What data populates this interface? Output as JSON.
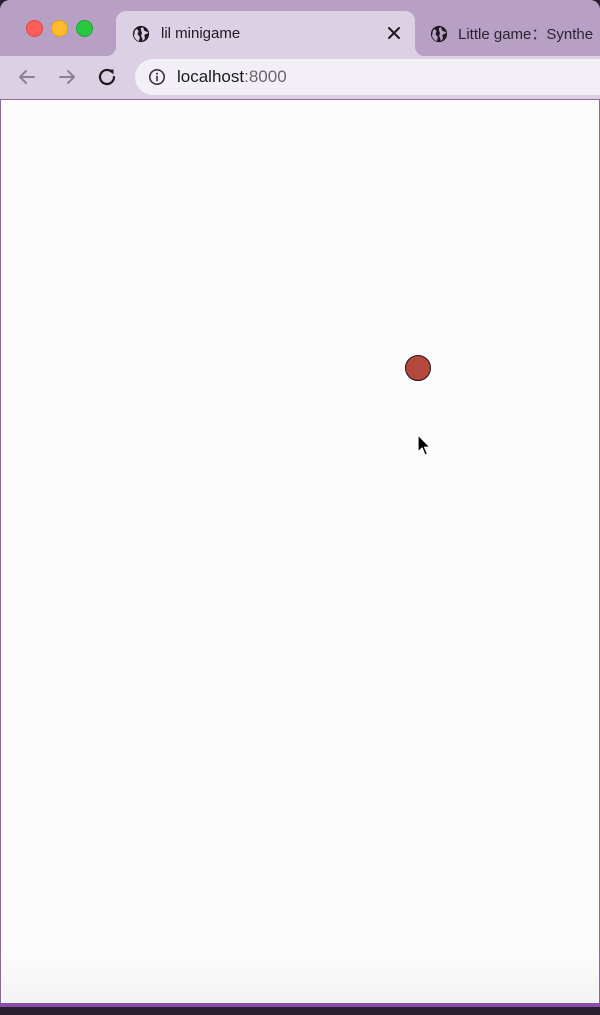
{
  "window": {
    "controls": [
      "close",
      "minimize",
      "zoom"
    ]
  },
  "tabs": [
    {
      "title": "lil minigame",
      "icon": "globe-icon",
      "active": true,
      "close_glyph": "✕"
    },
    {
      "title": "Little game：Synthe",
      "icon": "globe-icon",
      "active": false
    }
  ],
  "toolbar": {
    "back_icon": "arrow-left-icon",
    "forward_icon": "arrow-right-icon",
    "reload_icon": "reload-icon",
    "site_info_icon": "info-icon"
  },
  "address_bar": {
    "host": "localhost",
    "port": ":8000"
  },
  "game": {
    "player_color": "#b5483c",
    "background_color": "#fdfcfd"
  },
  "colors": {
    "tabstrip": "#b8a0c4",
    "active_tab": "#dcd0e4",
    "accent": "#8a4fa8"
  }
}
